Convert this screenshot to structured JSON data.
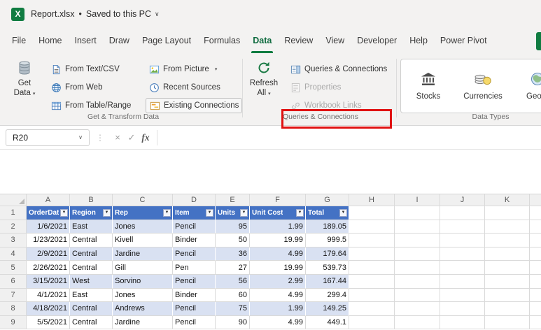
{
  "title_bar": {
    "filename": "Report.xlsx",
    "separator": "•",
    "saved_status": "Saved to this PC",
    "chevron": "∨"
  },
  "tabs": [
    {
      "label": "File"
    },
    {
      "label": "Home"
    },
    {
      "label": "Insert"
    },
    {
      "label": "Draw"
    },
    {
      "label": "Page Layout"
    },
    {
      "label": "Formulas"
    },
    {
      "label": "Data",
      "active": true
    },
    {
      "label": "Review"
    },
    {
      "label": "View"
    },
    {
      "label": "Developer"
    },
    {
      "label": "Help"
    },
    {
      "label": "Power Pivot"
    }
  ],
  "ribbon": {
    "get_transform_group": {
      "get_data_line1": "Get",
      "get_data_line2": "Data",
      "from_text_csv": "From Text/CSV",
      "from_web": "From Web",
      "from_table_range": "From Table/Range",
      "from_picture": "From Picture",
      "recent_sources": "Recent Sources",
      "existing_connections": "Existing Connections",
      "label": "Get & Transform Data"
    },
    "queries_group": {
      "refresh_line1": "Refresh",
      "refresh_line2": "All",
      "queries_connections": "Queries & Connections",
      "properties": "Properties",
      "workbook_links": "Workbook Links",
      "label": "Queries & Connections"
    },
    "data_types_group": {
      "stocks": "Stocks",
      "currencies": "Currencies",
      "geography_partial": "Geogr",
      "label": "Data Types"
    }
  },
  "formula_bar": {
    "name_box_value": "R20",
    "cancel_glyph": "×",
    "enter_glyph": "✓",
    "fx_label": "fx",
    "formula_value": ""
  },
  "sheet": {
    "column_headers": [
      "A",
      "B",
      "C",
      "D",
      "E",
      "F",
      "G",
      "H",
      "I",
      "J",
      "K"
    ],
    "row_headers": [
      "1",
      "2",
      "3",
      "4",
      "5",
      "6",
      "7",
      "8",
      "9"
    ],
    "table": {
      "headers": [
        "OrderDate",
        "Region",
        "Rep",
        "Item",
        "Units",
        "Unit Cost",
        "Total"
      ],
      "rows": [
        [
          "1/6/2021",
          "East",
          "Jones",
          "Pencil",
          "95",
          "1.99",
          "189.05"
        ],
        [
          "1/23/2021",
          "Central",
          "Kivell",
          "Binder",
          "50",
          "19.99",
          "999.5"
        ],
        [
          "2/9/2021",
          "Central",
          "Jardine",
          "Pencil",
          "36",
          "4.99",
          "179.64"
        ],
        [
          "2/26/2021",
          "Central",
          "Gill",
          "Pen",
          "27",
          "19.99",
          "539.73"
        ],
        [
          "3/15/2021",
          "West",
          "Sorvino",
          "Pencil",
          "56",
          "2.99",
          "167.44"
        ],
        [
          "4/1/2021",
          "East",
          "Jones",
          "Binder",
          "60",
          "4.99",
          "299.4"
        ],
        [
          "4/18/2021",
          "Central",
          "Andrews",
          "Pencil",
          "75",
          "1.99",
          "149.25"
        ],
        [
          "5/5/2021",
          "Central",
          "Jardine",
          "Pencil",
          "90",
          "4.99",
          "449.1"
        ]
      ]
    }
  },
  "icons": {
    "excel_logo_letter": "X",
    "dropdown_caret": "▾",
    "filter_arrow": "▼",
    "dots_separator": "⋮"
  },
  "colors": {
    "excel_green": "#107C41",
    "table_header_bg": "#4472C4",
    "banded_row_bg": "#D9E1F2",
    "annotation_red": "#E01212",
    "disabled_text": "#A9A9A9"
  }
}
